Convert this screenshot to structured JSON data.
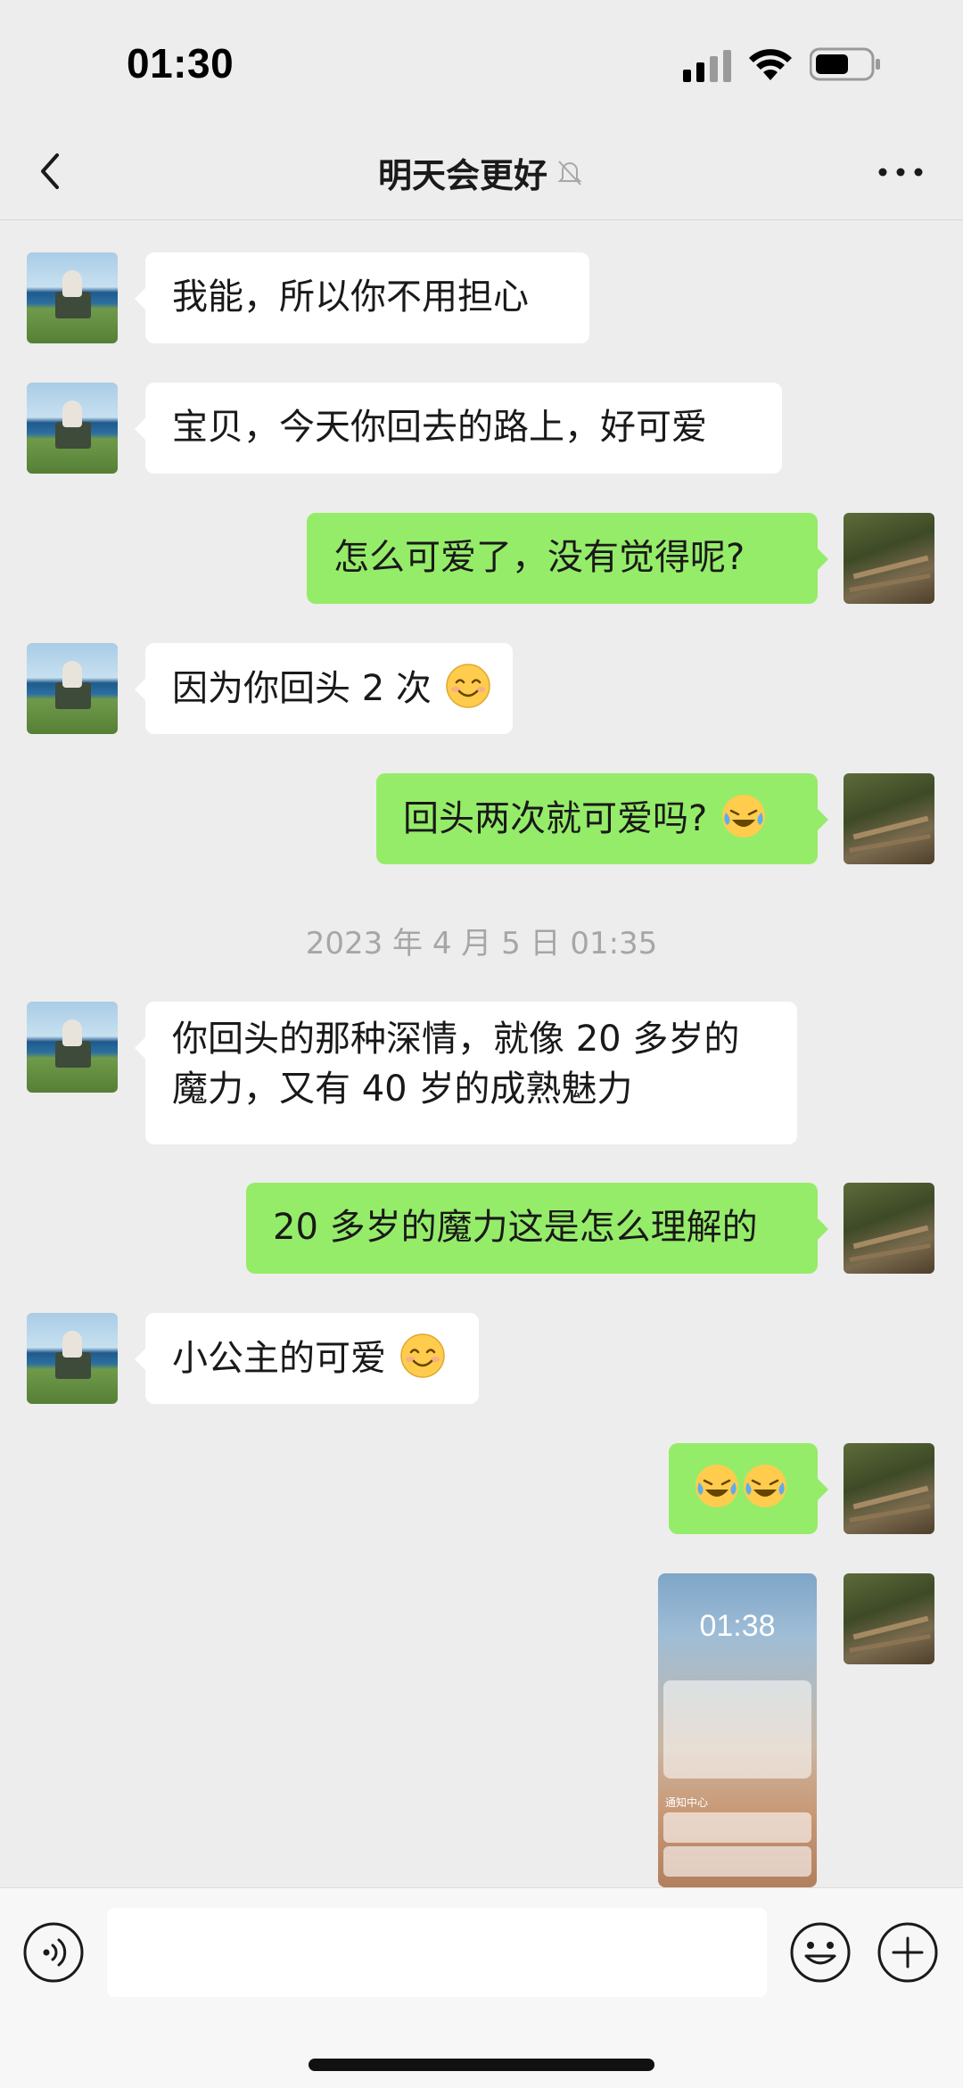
{
  "status_bar": {
    "time": "01:30"
  },
  "header": {
    "title": "明天会更好",
    "muted": true
  },
  "messages": [
    {
      "side": "left",
      "text": "我能，所以你不用担心"
    },
    {
      "side": "left",
      "text": "宝贝，今天你回去的路上，好可爱"
    },
    {
      "side": "right",
      "text": "怎么可爱了，没有觉得呢?"
    },
    {
      "side": "left",
      "text": "因为你回头 2 次",
      "emoji": "smiling-face"
    },
    {
      "side": "right",
      "text": "回头两次就可爱吗?",
      "emoji": "laughing-crying-face"
    },
    {
      "side": "left",
      "text": "你回头的那种深情，就像 20 多岁的魔力，又有 40 岁的成熟魅力"
    },
    {
      "side": "right",
      "text": "20 多岁的魔力这是怎么理解的"
    },
    {
      "side": "left",
      "text": "小公主的可爱",
      "emoji": "smiling-face"
    },
    {
      "side": "right",
      "text": "",
      "emoji": "laughing-crying-face x2"
    },
    {
      "side": "right",
      "type": "image",
      "caption": "lock screen screenshot"
    }
  ],
  "timestamp": "2023 年 4 月 5 日 01:35",
  "screenshot_image": {
    "time": "01:38",
    "section_label": "通知中心"
  },
  "input_bar": {
    "placeholder": ""
  },
  "colors": {
    "background": "#ededed",
    "bubble_left": "#ffffff",
    "bubble_right": "#95ec69"
  }
}
